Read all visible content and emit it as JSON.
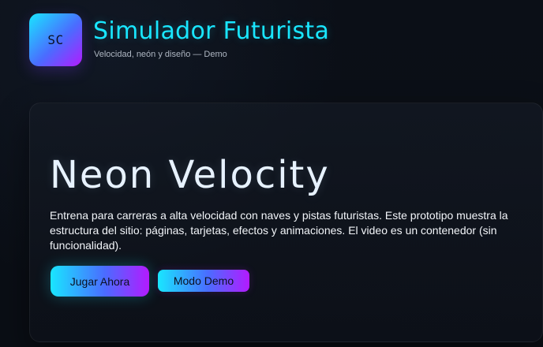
{
  "header": {
    "logo_text": "SC",
    "title": "Simulador Futurista",
    "subtitle": "Velocidad, neón y diseño — Demo"
  },
  "hero": {
    "title": "Neon Velocity",
    "description": "Entrena para carreras a alta velocidad con naves y pistas futuristas. Este prototipo muestra la estructura del sitio: páginas, tarjetas, efectos y animaciones. El video es un contenedor (sin funcionalidad).",
    "primary_button_label": "Jugar Ahora",
    "secondary_button_label": "Modo Demo"
  },
  "colors": {
    "background": "#0b0f17",
    "accent_cyan": "#19e6ff",
    "accent_blue": "#4a6cff",
    "accent_purple": "#b31bff",
    "text_primary": "#f2f5f9",
    "text_muted": "#aeb6c2"
  }
}
